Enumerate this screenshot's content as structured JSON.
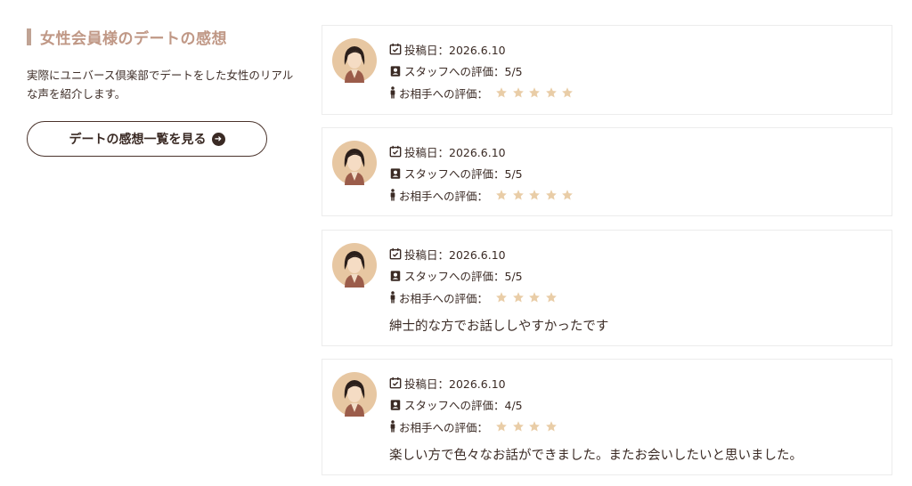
{
  "section": {
    "title": "女性会員様のデートの感想",
    "intro": "実際にユニバース倶楽部でデートをした女性のリアルな声を紹介します。",
    "more_button": "デートの感想一覧を見る"
  },
  "colors": {
    "star": "#e9cda7",
    "accent": "#c09886",
    "text": "#3a2a24"
  },
  "reviews": [
    {
      "date_label": "投稿日：2026.6.10",
      "staff_label": "スタッフへの評価：5/5",
      "partner_label": "お相手への評価：",
      "partner_rating": 5,
      "comment": ""
    },
    {
      "date_label": "投稿日：2026.6.10",
      "staff_label": "スタッフへの評価：5/5",
      "partner_label": "お相手への評価：",
      "partner_rating": 5,
      "comment": ""
    },
    {
      "date_label": "投稿日：2026.6.10",
      "staff_label": "スタッフへの評価：5/5",
      "partner_label": "お相手への評価：",
      "partner_rating": 4,
      "comment": "紳士的な方でお話ししやすかったです"
    },
    {
      "date_label": "投稿日：2026.6.10",
      "staff_label": "スタッフへの評価：4/5",
      "partner_label": "お相手への評価：",
      "partner_rating": 4,
      "comment": "楽しい方で色々なお話ができました。またお会いしたいと思いました。"
    }
  ]
}
